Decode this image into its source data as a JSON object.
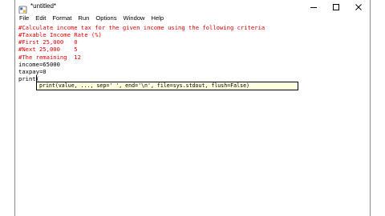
{
  "window": {
    "title": "*untitled*",
    "controls": {
      "minimize_icon": "minimize-icon",
      "maximize_icon": "maximize-icon",
      "close_icon": "close-icon"
    }
  },
  "menu": {
    "items": [
      "File",
      "Edit",
      "Format",
      "Run",
      "Options",
      "Window",
      "Help"
    ]
  },
  "editor": {
    "lines": [
      {
        "text": "#Calculate income tax for the given income using the following criteria",
        "kind": "comment"
      },
      {
        "text": "#Taxable Income Rate (%)",
        "kind": "comment"
      },
      {
        "text": "#First 25,000   0",
        "kind": "comment"
      },
      {
        "text": "#Next 25,000    5",
        "kind": "comment"
      },
      {
        "text": "#The remaining  12",
        "kind": "comment"
      },
      {
        "text": "income=65000",
        "kind": "code"
      },
      {
        "text": "taxpay=0",
        "kind": "code"
      },
      {
        "text": "print(",
        "kind": "code"
      }
    ],
    "calltip": "print(value, ..., sep=' ', end='\\n', file=sys.stdout, flush=False)"
  },
  "colors": {
    "comment": "#dd0000",
    "code": "#000000",
    "calltip_bg": "#ffffe0"
  }
}
